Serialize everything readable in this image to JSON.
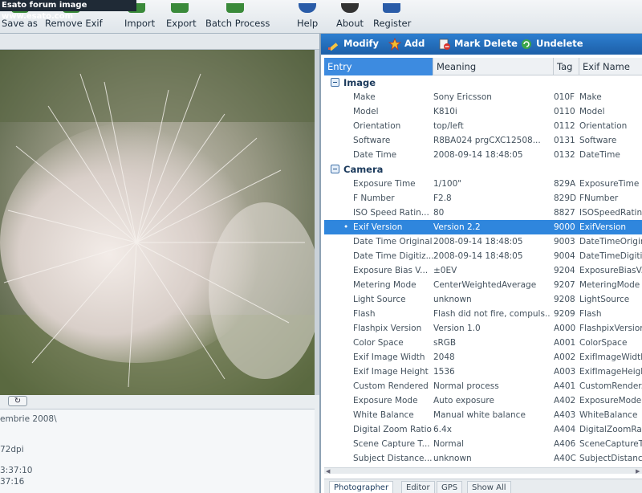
{
  "watermark": "Esato forum image www.esato.com",
  "toolbar": {
    "buttons": [
      {
        "label": "Save as",
        "icon": "save-icon",
        "color": "#3a8a3a"
      },
      {
        "label": "Remove Exif",
        "icon": "remove-exif-icon",
        "color": "#3a8a3a"
      },
      {
        "label": "Import",
        "icon": "import-icon",
        "color": "#3a8a3a"
      },
      {
        "label": "Export",
        "icon": "export-icon",
        "color": "#3a8a3a"
      },
      {
        "label": "Batch Process",
        "icon": "batch-process-icon",
        "color": "#3a8a3a"
      },
      {
        "label": "Help",
        "icon": "help-icon",
        "color": "#2a5ca8"
      },
      {
        "label": "About",
        "icon": "about-icon",
        "color": "#333333"
      },
      {
        "label": "Register",
        "icon": "register-icon",
        "color": "#2a5ca8"
      }
    ]
  },
  "left_panel": {
    "rotate_symbol": "↻",
    "info_lines": [
      "embrie 2008\\",
      "72dpi",
      "3:37:10",
      "37:16"
    ]
  },
  "actions": {
    "modify": "Modify",
    "add": "Add",
    "mark_delete": "Mark Delete",
    "undelete": "Undelete"
  },
  "columns": {
    "entry": "Entry",
    "meaning": "Meaning",
    "tag": "Tag",
    "exif_name": "Exif Name"
  },
  "groups": {
    "image": "Image",
    "camera": "Camera"
  },
  "image_rows": [
    {
      "entry": "Make",
      "meaning": "Sony Ericsson",
      "tag": "010F",
      "exif": "Make"
    },
    {
      "entry": "Model",
      "meaning": "K810i",
      "tag": "0110",
      "exif": "Model"
    },
    {
      "entry": "Orientation",
      "meaning": "top/left",
      "tag": "0112",
      "exif": "Orientation"
    },
    {
      "entry": "Software",
      "meaning": "R8BA024    prgCXC12508...",
      "tag": "0131",
      "exif": "Software"
    },
    {
      "entry": "Date Time",
      "meaning": "2008-09-14 18:48:05",
      "tag": "0132",
      "exif": "DateTime"
    }
  ],
  "camera_rows": [
    {
      "entry": "Exposure Time",
      "meaning": "1/100\"",
      "tag": "829A",
      "exif": "ExposureTime"
    },
    {
      "entry": "F Number",
      "meaning": "F2.8",
      "tag": "829D",
      "exif": "FNumber"
    },
    {
      "entry": "ISO Speed Ratin...",
      "meaning": "80",
      "tag": "8827",
      "exif": "ISOSpeedRatin..."
    },
    {
      "entry": "Exif Version",
      "meaning": "Version 2.2",
      "tag": "9000",
      "exif": "ExifVersion",
      "selected": true
    },
    {
      "entry": "Date Time Original",
      "meaning": "2008-09-14 18:48:05",
      "tag": "9003",
      "exif": "DateTimeOriginal"
    },
    {
      "entry": "Date Time Digitiz...",
      "meaning": "2008-09-14 18:48:05",
      "tag": "9004",
      "exif": "DateTimeDigitiz..."
    },
    {
      "entry": "Exposure Bias V...",
      "meaning": "±0EV",
      "tag": "9204",
      "exif": "ExposureBiasV..."
    },
    {
      "entry": "Metering Mode",
      "meaning": "CenterWeightedAverage",
      "tag": "9207",
      "exif": "MeteringMode"
    },
    {
      "entry": "Light Source",
      "meaning": "unknown",
      "tag": "9208",
      "exif": "LightSource"
    },
    {
      "entry": "Flash",
      "meaning": "Flash did not fire, compuls...",
      "tag": "9209",
      "exif": "Flash"
    },
    {
      "entry": "Flashpix Version",
      "meaning": "Version 1.0",
      "tag": "A000",
      "exif": "FlashpixVersion"
    },
    {
      "entry": "Color Space",
      "meaning": "sRGB",
      "tag": "A001",
      "exif": "ColorSpace"
    },
    {
      "entry": "Exif Image Width",
      "meaning": "2048",
      "tag": "A002",
      "exif": "ExifImageWidth"
    },
    {
      "entry": "Exif Image Height",
      "meaning": "1536",
      "tag": "A003",
      "exif": "ExifImageHeight"
    },
    {
      "entry": "Custom Rendered",
      "meaning": "Normal process",
      "tag": "A401",
      "exif": "CustomRender..."
    },
    {
      "entry": "Exposure Mode",
      "meaning": "Auto exposure",
      "tag": "A402",
      "exif": "ExposureMode"
    },
    {
      "entry": "White Balance",
      "meaning": "Manual white balance",
      "tag": "A403",
      "exif": "WhiteBalance"
    },
    {
      "entry": "Digital Zoom Ratio",
      "meaning": "6.4x",
      "tag": "A404",
      "exif": "DigitalZoomRatio"
    },
    {
      "entry": "Scene Capture T...",
      "meaning": "Normal",
      "tag": "A406",
      "exif": "SceneCaptureT..."
    },
    {
      "entry": "Subject Distance...",
      "meaning": "unknown",
      "tag": "A40C",
      "exif": "SubjectDistanc..."
    }
  ],
  "tabs": [
    "Photographer",
    "Editor",
    "GPS",
    "Show All"
  ],
  "colors": {
    "action_bar": "#1d5fa8",
    "selection": "#2f86dd"
  }
}
